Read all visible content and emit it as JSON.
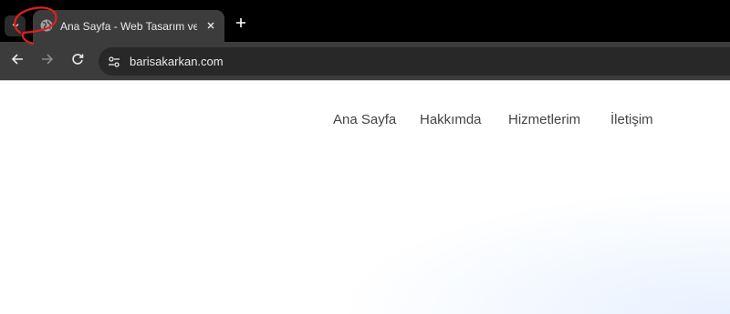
{
  "browser": {
    "tab": {
      "title": "Ana Sayfa - Web Tasarım ve SEO",
      "favicon": "globe-icon"
    },
    "address_bar": {
      "url": "barisakarkan.com"
    },
    "icons": {
      "tab_search": "chevron-down-icon",
      "close": "close-icon",
      "new_tab": "plus-icon",
      "back": "back-arrow-icon",
      "forward": "forward-arrow-icon",
      "reload": "reload-icon",
      "site_info": "tune-icon"
    }
  },
  "site_nav": {
    "items": [
      {
        "label": "Ana Sayfa"
      },
      {
        "label": "Hakkımda"
      },
      {
        "label": "Hizmetlerim"
      },
      {
        "label": "İletişim"
      }
    ]
  },
  "colors": {
    "tabstrip": "#000000",
    "toolbar": "#3c3c3c",
    "annotation": "#e0201e",
    "nav_text": "#444444"
  }
}
